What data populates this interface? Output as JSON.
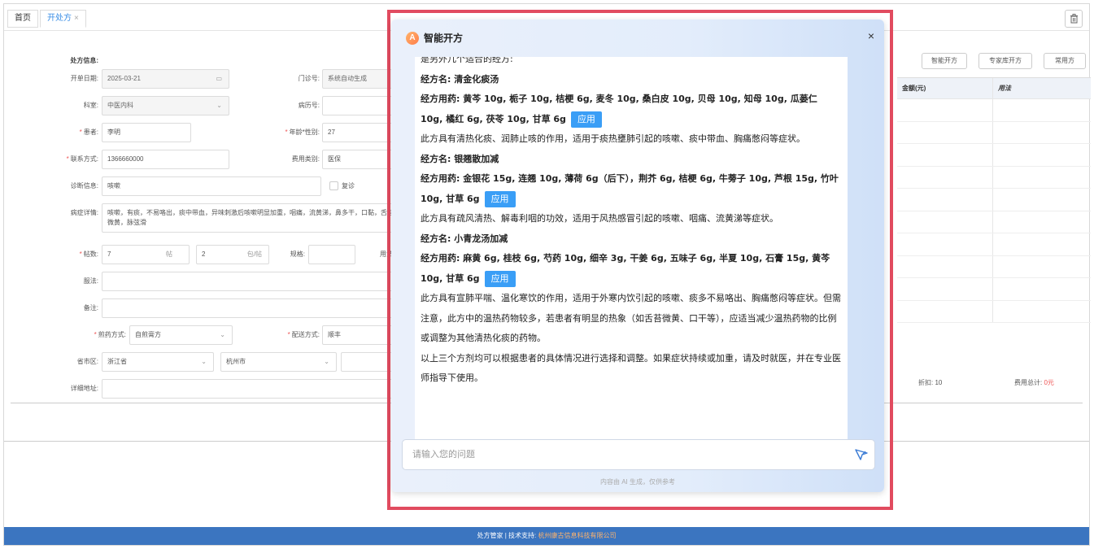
{
  "tabs": [
    {
      "label": "首页"
    },
    {
      "label": "开处方",
      "close": "×"
    }
  ],
  "form": {
    "section_title": "处方信息:",
    "date_label": "开单日期:",
    "date_value": "2025-03-21",
    "clinic_no_label": "门诊号:",
    "clinic_no_value": "系统自动生成",
    "dept_label": "科室:",
    "dept_value": "中医内科",
    "record_no_label": "病历号:",
    "patient_label": "患者:",
    "patient_value": "李明",
    "age_gender_label": "年龄*性别:",
    "age_value": "27",
    "contact_label": "联系方式:",
    "contact_value": "1366660000",
    "fee_type_label": "费用类别:",
    "fee_type_value": "医保",
    "diagnosis_label": "诊断信息:",
    "diagnosis_value": "咳嗽",
    "revisit_label": "复诊",
    "symptom_label": "病症详情:",
    "symptom_value": "咳嗽，有痰，不易咯出，痰中带血，异味刺激后咳嗽明显加重，咽痛，流黄涕，鼻多干，口黏，舌苔微黄，脉弦滑",
    "doses_label": "帖数:",
    "doses_value": "7",
    "doses_unit": "帖",
    "bags_value": "2",
    "bags_unit": "包/帖",
    "spec_label": "规格:",
    "usage_label": "用法",
    "take_label": "服法:",
    "remark_label": "备注:",
    "decoct_label": "煎药方式:",
    "decoct_value": "自煎膏方",
    "delivery_label": "配送方式:",
    "delivery_value": "顺丰",
    "region_label": "省市区:",
    "province_value": "浙江省",
    "city_value": "杭州市",
    "address_label": "详细地址:"
  },
  "right": {
    "buttons": [
      "智能开方",
      "专家库开方",
      "常用方"
    ],
    "col_amount": "金额(元)",
    "col_usage": "用法",
    "discount": "折扣: 10",
    "total_label": "费用总计: ",
    "total_value": "0元"
  },
  "dialog": {
    "title": "智能开方",
    "close": "×",
    "logo": "A",
    "intro": "是另外几个适合的经方:",
    "rx1_name": "经方名: 清金化痰汤",
    "rx1_herbs": "经方用药: 黄芩 10g, 栀子 10g, 桔梗 6g, 麦冬 10g, 桑白皮 10g, 贝母 10g, 知母 10g, 瓜蒌仁 10g, 橘红 6g, 茯苓 10g, 甘草 6g",
    "rx1_desc": "此方具有清热化痰、润肺止咳的作用，适用于痰热壅肺引起的咳嗽、痰中带血、胸痛憋闷等症状。",
    "rx2_name": "经方名: 银翘散加减",
    "rx2_herbs": "经方用药: 金银花 15g, 连翘 10g, 薄荷 6g（后下），荆芥 6g, 桔梗 6g, 牛蒡子 10g, 芦根 15g, 竹叶 10g, 甘草 6g",
    "rx2_desc": "此方具有疏风清热、解毒利咽的功效，适用于风热感冒引起的咳嗽、咽痛、流黄涕等症状。",
    "rx3_name": "经方名: 小青龙汤加减",
    "rx3_herbs": "经方用药: 麻黄 6g, 桂枝 6g, 芍药 10g, 细辛 3g, 干姜 6g, 五味子 6g, 半夏 10g, 石膏 15g, 黄芩 10g, 甘草 6g",
    "rx3_desc": "此方具有宣肺平喘、温化寒饮的作用，适用于外寒内饮引起的咳嗽、痰多不易咯出、胸痛憋闷等症状。但需注意，此方中的温热药物较多，若患者有明显的热象（如舌苔微黄、口干等），应适当减少温热药物的比例或调整为其他清热化痰的药物。",
    "conclusion": "以上三个方剂均可以根据患者的具体情况进行选择和调整。如果症状持续或加重，请及时就医，并在专业医师指导下使用。",
    "apply_label": "应用",
    "input_placeholder": "请输入您的问题",
    "disclaimer": "内容由 AI 生成，仅供参考"
  },
  "footer": {
    "text": "处方管家 | 技术支持: ",
    "org": "杭州康古信息科技有限公司"
  }
}
